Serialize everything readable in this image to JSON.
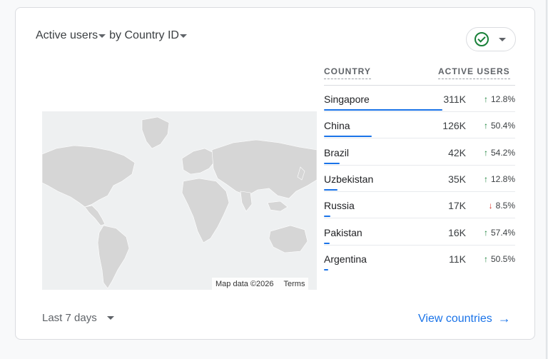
{
  "card": {
    "title_metric": "Active users",
    "title_dimension": "by Country ID",
    "status_icon": "check-circle-icon",
    "status_color": "#188038"
  },
  "map": {
    "zoom_in": "+",
    "zoom_out": "—",
    "attribution": "Map data ©2026",
    "terms": "Terms"
  },
  "table": {
    "headers": {
      "country": "COUNTRY",
      "users": "ACTIVE USERS"
    },
    "rows": [
      {
        "country": "Singapore",
        "users": "311K",
        "change": "12.8%",
        "direction": "up",
        "share": 1.0
      },
      {
        "country": "China",
        "users": "126K",
        "change": "50.4%",
        "direction": "up",
        "share": 0.405
      },
      {
        "country": "Brazil",
        "users": "42K",
        "change": "54.2%",
        "direction": "up",
        "share": 0.135
      },
      {
        "country": "Uzbekistan",
        "users": "35K",
        "change": "12.8%",
        "direction": "up",
        "share": 0.113
      },
      {
        "country": "Russia",
        "users": "17K",
        "change": "8.5%",
        "direction": "down",
        "share": 0.055
      },
      {
        "country": "Pakistan",
        "users": "16K",
        "change": "57.4%",
        "direction": "up",
        "share": 0.051
      },
      {
        "country": "Argentina",
        "users": "11K",
        "change": "50.5%",
        "direction": "up",
        "share": 0.035
      }
    ]
  },
  "footer": {
    "date_range": "Last 7 days",
    "view_link": "View countries"
  },
  "colors": {
    "accent": "#1a73e8",
    "up": "#188038",
    "down": "#d93025"
  }
}
